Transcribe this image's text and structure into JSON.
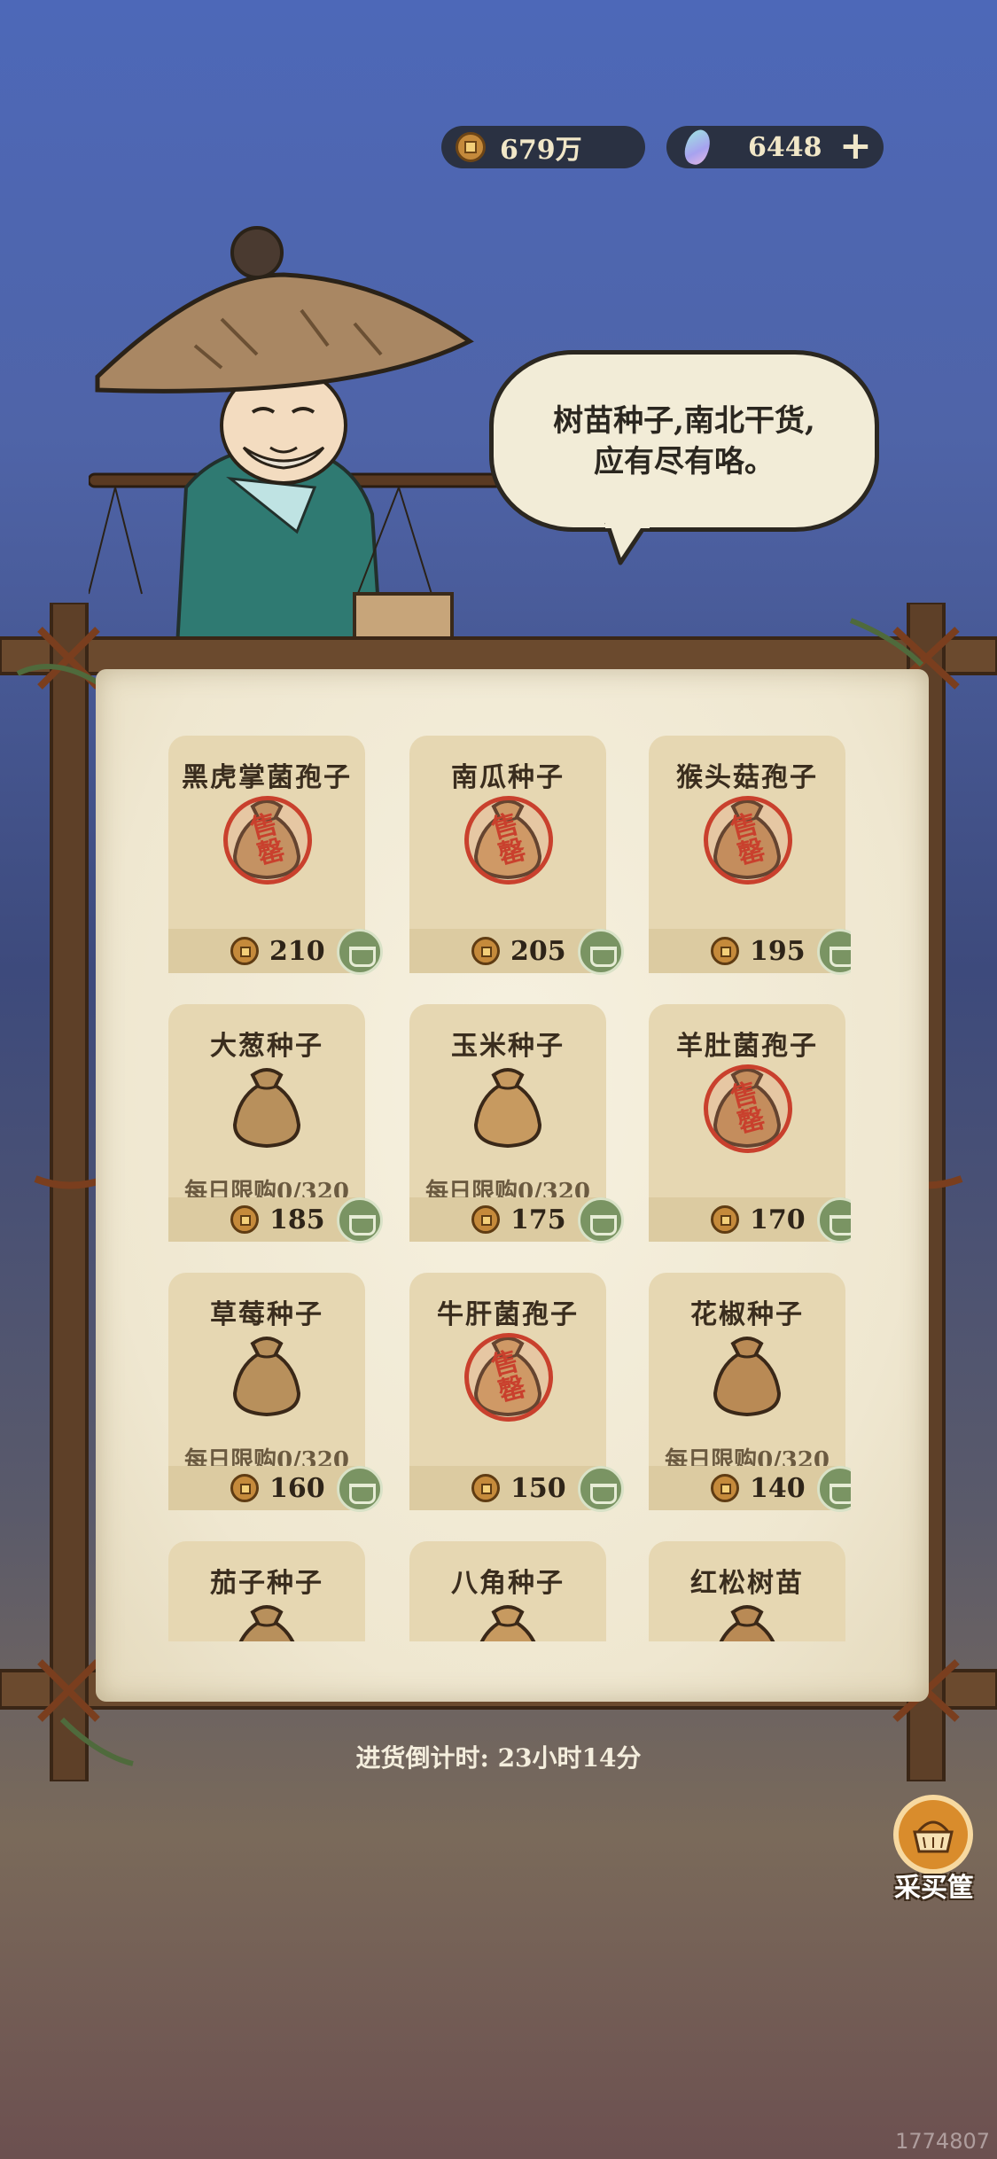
{
  "currency": {
    "coins": "679万",
    "gems": "6448"
  },
  "merchant": {
    "speech": [
      "树苗种子,南北干货,",
      "应有尽有咯。"
    ]
  },
  "shop": {
    "items": [
      {
        "name": "黑虎掌菌孢子",
        "price": "210",
        "sold_out_stamp": "售罄",
        "limit": ""
      },
      {
        "name": "南瓜种子",
        "price": "205",
        "sold_out_stamp": "售罄",
        "limit": ""
      },
      {
        "name": "猴头菇孢子",
        "price": "195",
        "sold_out_stamp": "售罄",
        "limit": ""
      },
      {
        "name": "大葱种子",
        "price": "185",
        "sold_out_stamp": "",
        "limit": "每日限购0/320"
      },
      {
        "name": "玉米种子",
        "price": "175",
        "sold_out_stamp": "",
        "limit": "每日限购0/320"
      },
      {
        "name": "羊肚菌孢子",
        "price": "170",
        "sold_out_stamp": "售罄",
        "limit": ""
      },
      {
        "name": "草莓种子",
        "price": "160",
        "sold_out_stamp": "",
        "limit": "每日限购0/320"
      },
      {
        "name": "牛肝菌孢子",
        "price": "150",
        "sold_out_stamp": "售罄",
        "limit": ""
      },
      {
        "name": "花椒种子",
        "price": "140",
        "sold_out_stamp": "",
        "limit": "每日限购0/320"
      },
      {
        "name": "茄子种子",
        "price": "",
        "sold_out_stamp": "",
        "limit": ""
      },
      {
        "name": "八角种子",
        "price": "",
        "sold_out_stamp": "",
        "limit": ""
      },
      {
        "name": "红松树苗",
        "price": "",
        "sold_out_stamp": "",
        "limit": ""
      }
    ],
    "restock_timer": "进货倒计时: 23小时14分"
  },
  "cart": {
    "label": "采买筐"
  },
  "build_id": "1774807",
  "colors": {
    "paper": "#efe7d0",
    "card": "#e6d7b2",
    "stamp": "#c9402d",
    "wood": "#6b4a2e"
  },
  "icons": {
    "coin": "coin-icon",
    "gem": "gem-icon",
    "add": "plus-icon",
    "bag": "seed-bag-icon",
    "basket": "basket-icon"
  }
}
